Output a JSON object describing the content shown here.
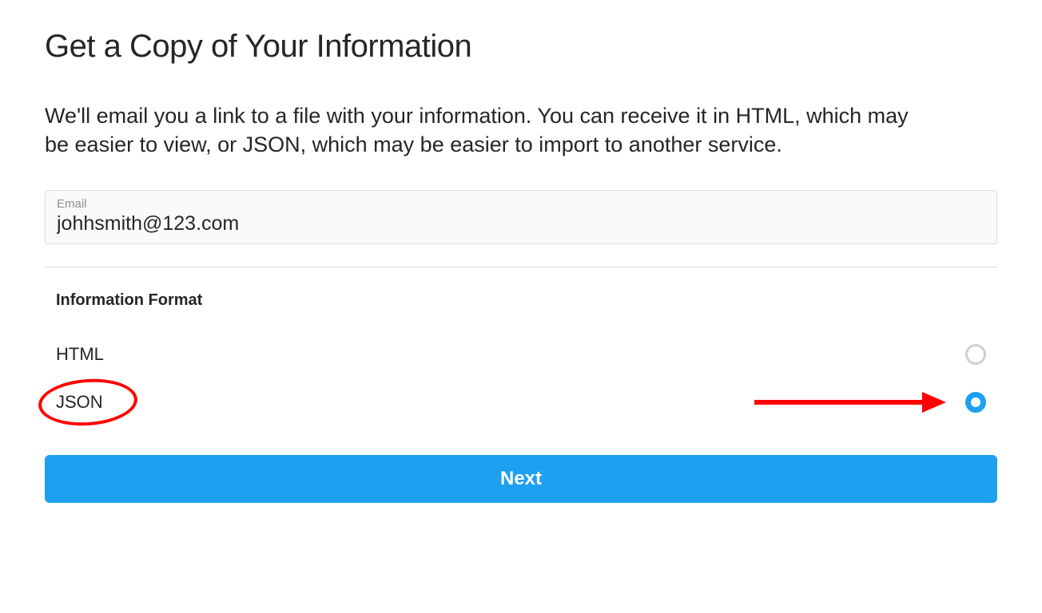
{
  "page": {
    "title": "Get a Copy of Your Information",
    "description": "We'll email you a link to a file with your information. You can receive it in HTML, which may be easier to view, or JSON, which may be easier to import to another service."
  },
  "email": {
    "label": "Email",
    "value": "johhsmith@123.com"
  },
  "format": {
    "heading": "Information Format",
    "options": [
      {
        "label": "HTML",
        "selected": false
      },
      {
        "label": "JSON",
        "selected": true
      }
    ]
  },
  "buttons": {
    "next": "Next"
  },
  "colors": {
    "accent": "#1ea0f1",
    "highlight": "#ff0000"
  }
}
